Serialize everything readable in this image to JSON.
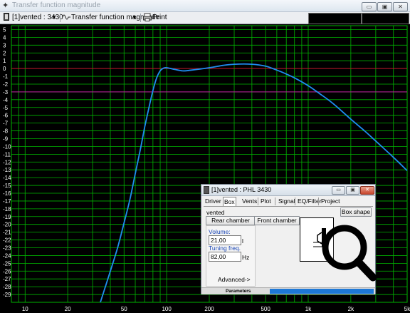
{
  "window": {
    "title": "Transfer function magnitude",
    "min_label": "▭",
    "max_label": "▣",
    "close_label": "✕"
  },
  "toolbar": {
    "driver_select": "[1]vented : 3430",
    "view_select": "Transfer function magnitude",
    "print_label": "Print",
    "dropdown_arrow": "▼"
  },
  "chart_data": {
    "type": "line",
    "title": "",
    "xlabel": "",
    "ylabel": "",
    "x_scale": "log",
    "xlim": [
      8,
      5000
    ],
    "ylim": [
      -30,
      5.5
    ],
    "y_ticks": [
      5,
      4,
      3,
      2,
      1,
      0,
      -1,
      -2,
      -3,
      -4,
      -5,
      -6,
      -7,
      -8,
      -9,
      -10,
      -11,
      -12,
      -13,
      -14,
      -15,
      -16,
      -17,
      -18,
      -19,
      -20,
      -21,
      -22,
      -23,
      -24,
      -25,
      -26,
      -27,
      -28,
      -29
    ],
    "x_tick_labels": [
      "10",
      "20",
      "50",
      "100",
      "200",
      "500",
      "1k",
      "2k",
      "5k"
    ],
    "x_tick_values": [
      10,
      20,
      50,
      100,
      200,
      500,
      1000,
      2000,
      5000
    ],
    "grid": true,
    "grid_color": "#00b400",
    "background": "#000000",
    "reference_lines": [
      {
        "y": 0,
        "color": "#c0102a"
      },
      {
        "y": -3,
        "color": "#c020a0"
      }
    ],
    "series": [
      {
        "color": "#1e8ef0",
        "x": [
          34,
          40,
          45,
          50,
          55,
          60,
          65,
          70,
          75,
          80,
          85,
          90,
          95,
          100,
          110,
          130,
          150,
          200,
          250,
          300,
          400,
          500,
          600,
          700,
          800,
          1000,
          1200,
          1500,
          2000,
          2500,
          3000,
          4000,
          5000
        ],
        "y": [
          -30,
          -26,
          -23,
          -19.8,
          -16.8,
          -13.5,
          -10.5,
          -7.5,
          -5,
          -2.8,
          -1.2,
          -0.3,
          0.05,
          0.1,
          -0.05,
          -0.3,
          -0.2,
          0.1,
          0.4,
          0.55,
          0.55,
          0.3,
          -0.2,
          -0.7,
          -1.2,
          -2.2,
          -3.2,
          -4.5,
          -6.5,
          -8,
          -9.3,
          -11.4,
          -13.1
        ]
      }
    ]
  },
  "dialog": {
    "title": "[1]vented : PHL 3430",
    "tabs": [
      "Driver",
      "Box",
      "Vents",
      "Plot",
      "Signal",
      "EQ/Filter",
      "Project"
    ],
    "active_tab": "Box",
    "box_name": "vented",
    "box_shape_button": "Box shape",
    "rear_chamber_button": "Rear chamber",
    "front_chamber_button": "Front chamber",
    "volume_label": "Volume:",
    "volume_value": "21,00",
    "volume_unit": "l",
    "tuning_label": "Tuning freq.",
    "tuning_value": "82,00",
    "tuning_unit": "Hz",
    "advanced_button": "Advanced->",
    "status_text": "Parameters",
    "status_progress": 1.0
  }
}
